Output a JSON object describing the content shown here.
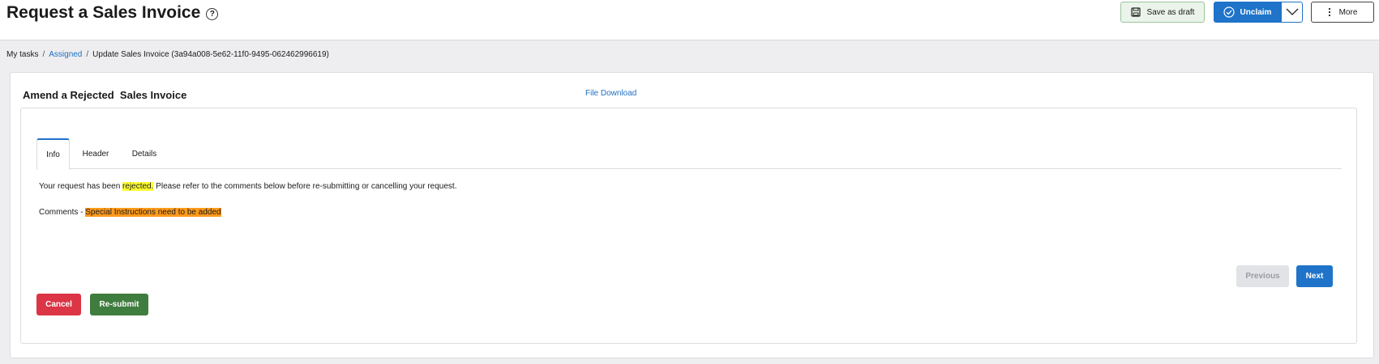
{
  "header": {
    "title": "Request a Sales Invoice",
    "help_icon": "question-circle-icon",
    "save_draft_label": "Save as draft",
    "save_icon": "floppy-disk-icon",
    "unclaim_label": "Unclaim",
    "unclaim_icon": "check-circle-icon",
    "unclaim_dropdown_icon": "chevron-down-icon",
    "more_label": "More",
    "more_icon": "vertical-ellipsis-icon"
  },
  "breadcrumb": {
    "items": [
      "My tasks",
      "Assigned",
      "Update Sales Invoice (3a94a008-5e62-11f0-9495-062462996619)"
    ],
    "separator": "/"
  },
  "card": {
    "title": "Amend a Rejected  Sales Invoice",
    "file_download_label": "File Download"
  },
  "tabs": [
    {
      "label": "Info",
      "active": true
    },
    {
      "label": "Header",
      "active": false
    },
    {
      "label": "Details",
      "active": false
    }
  ],
  "info": {
    "message_prefix": "Your request has been ",
    "message_highlight": "rejected.",
    "message_suffix": " Please refer to the comments below before re-submitting or cancelling your request.",
    "comments_label": "Comments - ",
    "comments_value": "Special Instructions need to be added"
  },
  "nav": {
    "previous_label": "Previous",
    "next_label": "Next"
  },
  "actions": {
    "cancel_label": "Cancel",
    "resubmit_label": "Re-submit"
  },
  "colors": {
    "primary": "#1f73c9",
    "danger": "#dc3545",
    "success": "#3f7d3f",
    "highlight_yellow": "#ffff33",
    "highlight_orange": "#ff9a1a"
  }
}
